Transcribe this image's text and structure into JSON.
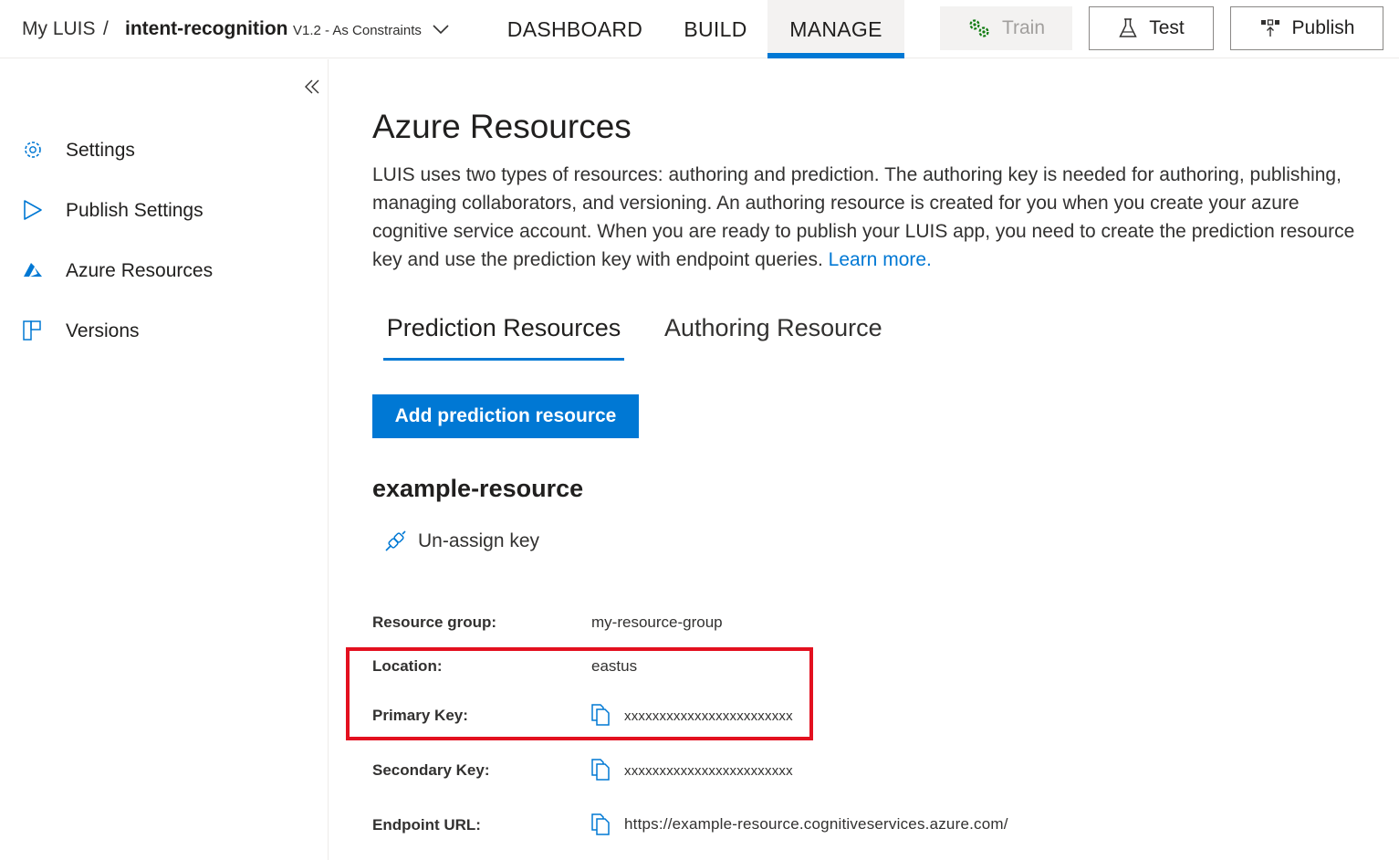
{
  "header": {
    "breadcrumb_home": "My LUIS",
    "breadcrumb_sep": "/",
    "app_name": "intent-recognition",
    "version": "V1.2 - As Constraints",
    "nav": {
      "dashboard": "DASHBOARD",
      "build": "BUILD",
      "manage": "MANAGE"
    },
    "active_nav": "MANAGE",
    "buttons": {
      "train": "Train",
      "test": "Test",
      "publish": "Publish"
    }
  },
  "sidebar": {
    "items": [
      {
        "label": "Settings",
        "icon": "gear-icon"
      },
      {
        "label": "Publish Settings",
        "icon": "play-icon"
      },
      {
        "label": "Azure Resources",
        "icon": "azure-icon"
      },
      {
        "label": "Versions",
        "icon": "versions-icon"
      }
    ]
  },
  "main": {
    "title": "Azure Resources",
    "description": "LUIS uses two types of resources: authoring and prediction. The authoring key is needed for authoring, publishing, managing collaborators, and versioning. An authoring resource is created for you when you create your azure cognitive service account. When you are ready to publish your LUIS app, you need to create the prediction resource key and use the prediction key with endpoint queries.",
    "learn_more": "Learn more.",
    "tabs": {
      "prediction": "Prediction Resources",
      "authoring": "Authoring Resource"
    },
    "active_tab": "Prediction Resources",
    "add_button": "Add prediction resource",
    "resource": {
      "name": "example-resource",
      "unassign_label": "Un-assign key",
      "resource_group_label": "Resource group:",
      "resource_group": "my-resource-group",
      "location_label": "Location:",
      "location": "eastus",
      "primary_key_label": "Primary Key:",
      "primary_key": "xxxxxxxxxxxxxxxxxxxxxxxx",
      "secondary_key_label": "Secondary Key:",
      "secondary_key": "xxxxxxxxxxxxxxxxxxxxxxxx",
      "endpoint_label": "Endpoint URL:",
      "endpoint": "https://example-resource.cognitiveservices.azure.com/"
    }
  },
  "colors": {
    "accent": "#0078d4",
    "highlight": "#e3101f",
    "train_icon": "#107c10"
  }
}
